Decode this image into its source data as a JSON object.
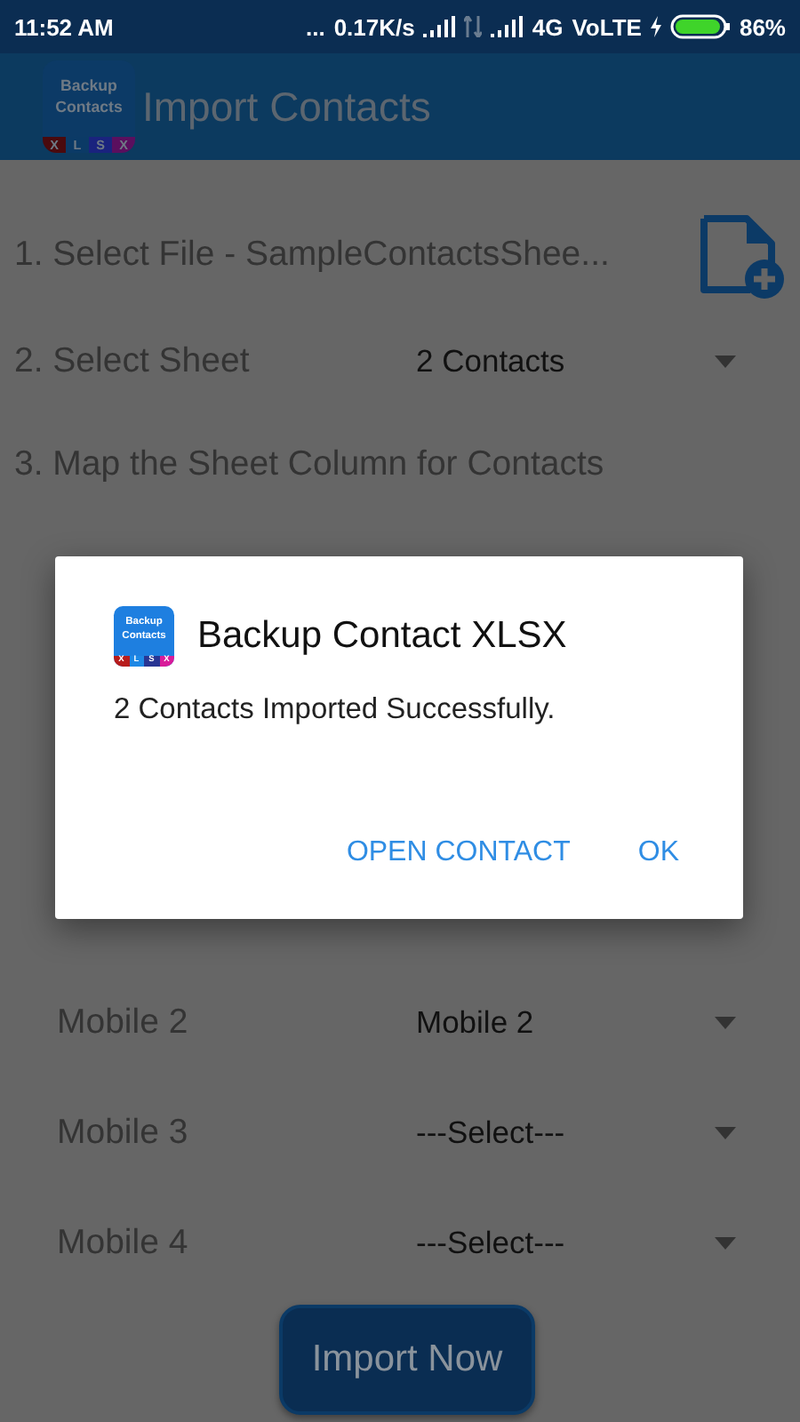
{
  "status_bar": {
    "time": "11:52 AM",
    "dots": "...",
    "speed": "0.17K/s",
    "network": "4G",
    "volte": "VoLTE",
    "battery": "86%"
  },
  "app_bar": {
    "logo": {
      "lines": [
        "Backup",
        "Contacts"
      ],
      "letters": [
        {
          "text": "X",
          "color": "#4a0a0e"
        },
        {
          "text": "L",
          "color": "#0b3a66"
        },
        {
          "text": "S",
          "color": "#1a237e"
        },
        {
          "text": "X",
          "color": "#5a0f5e"
        }
      ]
    },
    "title": "Import Contacts"
  },
  "steps": [
    {
      "kind": "file",
      "label": "1. Select File  -  SampleContactsShee..."
    },
    {
      "kind": "select",
      "label": "2. Select Sheet",
      "value": "2 Contacts"
    },
    {
      "kind": "heading",
      "label": "3. Map the Sheet Column for Contacts"
    }
  ],
  "mapping": [
    {
      "label": "Mobile 2",
      "value": "Mobile 2"
    },
    {
      "label": "Mobile 3",
      "value": "---Select---"
    },
    {
      "label": "Mobile 4",
      "value": "---Select---"
    }
  ],
  "import_button": "Import Now",
  "dialog": {
    "logo": {
      "lines": [
        "Backup",
        "Contacts"
      ],
      "letters": [
        {
          "text": "X",
          "color": "#b71c1c"
        },
        {
          "text": "L",
          "color": "#1e88e5"
        },
        {
          "text": "S",
          "color": "#283593"
        },
        {
          "text": "X",
          "color": "#d81b9a"
        }
      ]
    },
    "title": "Backup Contact XLSX",
    "message": "2 Contacts Imported Successfully.",
    "buttons": [
      "OPEN CONTACT",
      "OK"
    ]
  }
}
